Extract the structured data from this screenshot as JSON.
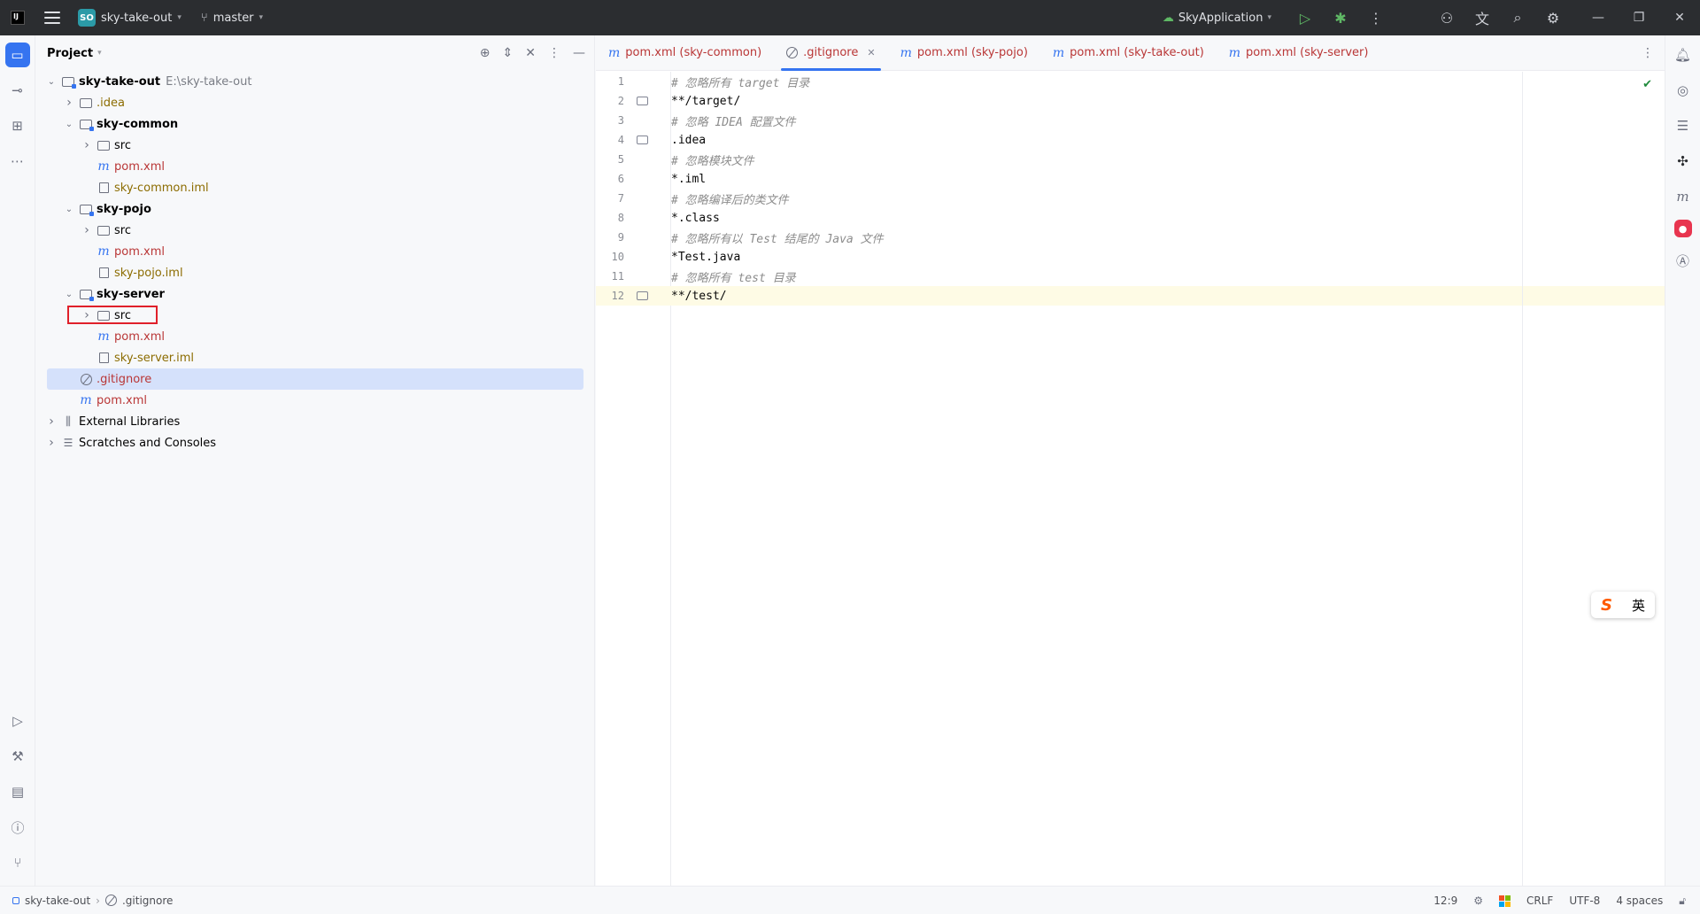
{
  "titlebar": {
    "project_badge": "SO",
    "project_name": "sky-take-out",
    "branch": "master",
    "run_config": "SkyApplication"
  },
  "project_panel": {
    "title": "Project",
    "tree": [
      {
        "label": "sky-take-out",
        "path": "E:\\sky-take-out",
        "depth": 0,
        "expanded": true,
        "icon": "module-folder-icon",
        "style": "bold"
      },
      {
        "label": ".idea",
        "depth": 1,
        "expanded": false,
        "icon": "folder-icon",
        "style": "olive"
      },
      {
        "label": "sky-common",
        "depth": 1,
        "expanded": true,
        "icon": "module-folder-icon",
        "style": "bold"
      },
      {
        "label": "src",
        "depth": 2,
        "expanded": false,
        "icon": "folder-icon",
        "style": "normal"
      },
      {
        "label": "pom.xml",
        "depth": 2,
        "icon": "maven-icon",
        "style": "red"
      },
      {
        "label": "sky-common.iml",
        "depth": 2,
        "icon": "iml-file-icon",
        "style": "olive"
      },
      {
        "label": "sky-pojo",
        "depth": 1,
        "expanded": true,
        "icon": "module-folder-icon",
        "style": "bold"
      },
      {
        "label": "src",
        "depth": 2,
        "expanded": false,
        "icon": "folder-icon",
        "style": "normal"
      },
      {
        "label": "pom.xml",
        "depth": 2,
        "icon": "maven-icon",
        "style": "red"
      },
      {
        "label": "sky-pojo.iml",
        "depth": 2,
        "icon": "iml-file-icon",
        "style": "olive"
      },
      {
        "label": "sky-server",
        "depth": 1,
        "expanded": true,
        "icon": "module-folder-icon",
        "style": "bold"
      },
      {
        "label": "src",
        "depth": 2,
        "expanded": false,
        "icon": "folder-icon",
        "style": "normal"
      },
      {
        "label": "pom.xml",
        "depth": 2,
        "icon": "maven-icon",
        "style": "red"
      },
      {
        "label": "sky-server.iml",
        "depth": 2,
        "icon": "iml-file-icon",
        "style": "olive"
      },
      {
        "label": ".gitignore",
        "depth": 1,
        "icon": "gitignore-icon",
        "style": "red",
        "selected": true
      },
      {
        "label": "pom.xml",
        "depth": 1,
        "icon": "maven-icon",
        "style": "red"
      },
      {
        "label": "External Libraries",
        "depth": 0,
        "expanded": false,
        "icon": "library-icon",
        "style": "normal"
      },
      {
        "label": "Scratches and Consoles",
        "depth": 0,
        "expanded": false,
        "icon": "scratches-icon",
        "style": "normal"
      }
    ]
  },
  "editor": {
    "tabs": [
      {
        "label": "pom.xml (sky-common)",
        "icon": "maven-icon",
        "active": false
      },
      {
        "label": ".gitignore",
        "icon": "gitignore-icon",
        "active": true
      },
      {
        "label": "pom.xml (sky-pojo)",
        "icon": "maven-icon",
        "active": false
      },
      {
        "label": "pom.xml (sky-take-out)",
        "icon": "maven-icon",
        "active": false
      },
      {
        "label": "pom.xml (sky-server)",
        "icon": "maven-icon",
        "active": false
      }
    ],
    "lines": [
      {
        "n": "1",
        "text": "# 忽略所有 target 目录",
        "comment": true,
        "fold": false
      },
      {
        "n": "2",
        "text": "**/target/",
        "comment": false,
        "fold": true
      },
      {
        "n": "3",
        "text": "# 忽略 IDEA 配置文件",
        "comment": true,
        "fold": false
      },
      {
        "n": "4",
        "text": ".idea",
        "comment": false,
        "fold": true
      },
      {
        "n": "5",
        "text": "# 忽略模块文件",
        "comment": true,
        "fold": false
      },
      {
        "n": "6",
        "text": "*.iml",
        "comment": false,
        "fold": false
      },
      {
        "n": "7",
        "text": "# 忽略编译后的类文件",
        "comment": true,
        "fold": false
      },
      {
        "n": "8",
        "text": "*.class",
        "comment": false,
        "fold": false
      },
      {
        "n": "9",
        "text": "# 忽略所有以 Test 结尾的 Java 文件",
        "comment": true,
        "fold": false
      },
      {
        "n": "10",
        "text": "*Test.java",
        "comment": false,
        "fold": false
      },
      {
        "n": "11",
        "text": "# 忽略所有 test 目录",
        "comment": true,
        "fold": false
      },
      {
        "n": "12",
        "text": "**/test/",
        "comment": false,
        "fold": true,
        "current": true
      }
    ]
  },
  "ime": {
    "logo": "S",
    "mode": "英"
  },
  "statusbar": {
    "crumb_project": "sky-take-out",
    "crumb_file": ".gitignore",
    "position": "12:9",
    "line_sep": "CRLF",
    "encoding": "UTF-8",
    "indent": "4 spaces"
  },
  "colors": {
    "accent": "#3574f0",
    "selection": "#d5e1fb",
    "highlight_box": "#e0202a",
    "vcs_added": "#b93636"
  }
}
